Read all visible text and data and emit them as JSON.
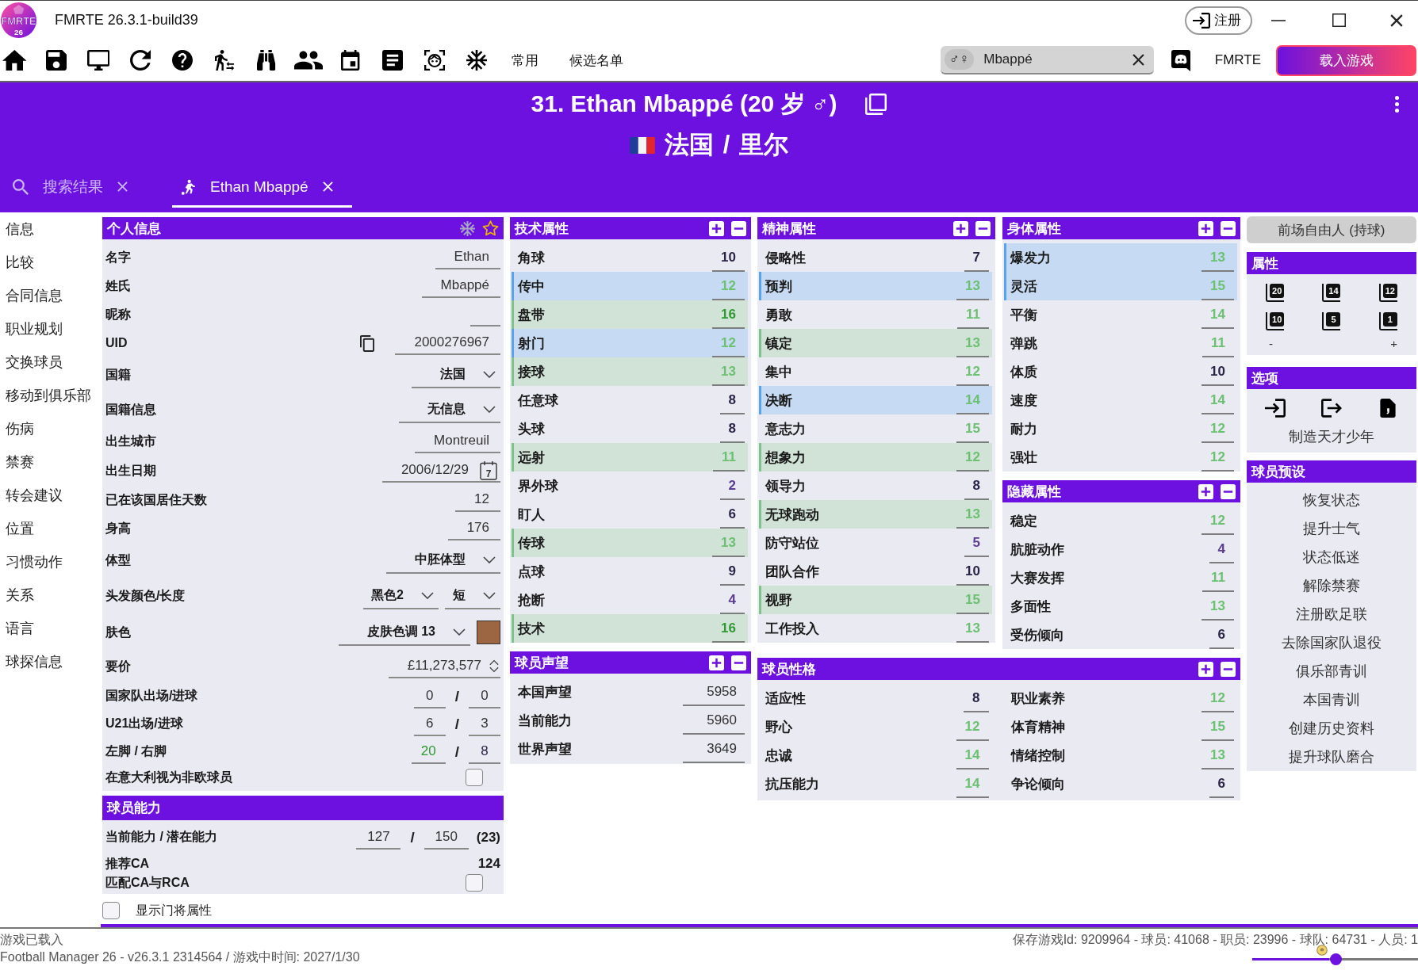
{
  "title_bar": {
    "logo": {
      "text": "FMRTE",
      "badge": "26"
    },
    "title": "FMRTE 26.3.1-build39",
    "register_button": "注册"
  },
  "toolbar": {
    "menus": [
      "常用",
      "候选名单"
    ],
    "search": {
      "gender_toggle": "♂♀",
      "value": "Mbappé"
    },
    "link": "FMRTE",
    "load_button": "载入游戏"
  },
  "player_header": {
    "title": "31. Ethan Mbappé (20 岁 ♂)",
    "nation": "法国",
    "separator": "/",
    "club": "里尔"
  },
  "tabs": [
    {
      "kind": "search",
      "label": "搜索结果",
      "selected": false
    },
    {
      "kind": "player",
      "label": "Ethan Mbappé",
      "selected": true
    }
  ],
  "sidebar": {
    "items": [
      "信息",
      "比较",
      "合同信息",
      "职业规划",
      "交换球员",
      "移动到俱乐部",
      "伤病",
      "禁赛",
      "转会建议",
      "位置",
      "习惯动作",
      "关系",
      "语言",
      "球探信息"
    ]
  },
  "personal_info": {
    "title": "个人信息",
    "fields": [
      {
        "kind": "text",
        "label": "名字",
        "value": "Ethan"
      },
      {
        "kind": "text",
        "label": "姓氏",
        "value": "Mbappé"
      },
      {
        "kind": "text",
        "label": "昵称"
      },
      {
        "kind": "copy",
        "label": "UID",
        "value": "2000276967"
      },
      {
        "kind": "select",
        "label": "国籍",
        "value": "法国"
      },
      {
        "kind": "select",
        "label": "国籍信息",
        "value": "无信息"
      },
      {
        "kind": "text",
        "label": "出生城市",
        "value": "Montreuil"
      },
      {
        "kind": "date",
        "label": "出生日期",
        "value": "2006/12/29",
        "calendar_day": "7"
      },
      {
        "kind": "text",
        "label": "已在该国居住天数",
        "value": "12"
      },
      {
        "kind": "text",
        "label": "身高",
        "value": "176"
      },
      {
        "kind": "select",
        "label": "体型",
        "value": "中胚体型"
      },
      {
        "kind": "select_pair",
        "label": "头发颜色/长度",
        "values": [
          "黑色2",
          "短"
        ]
      },
      {
        "kind": "swatch",
        "label": "肤色",
        "value": "皮肤色调 13",
        "color": "#9b6641"
      },
      {
        "kind": "spin",
        "label": "要价",
        "value": "£11,273,577"
      },
      {
        "kind": "pair",
        "label": "国家队出场/进球",
        "values": [
          "0",
          "0"
        ],
        "separator": "/"
      },
      {
        "kind": "pair",
        "label": "U21出场/进球",
        "values": [
          "6",
          "3"
        ],
        "separator": "/"
      },
      {
        "kind": "rating_pair",
        "label": "左脚 / 右脚",
        "values": [
          "20",
          "8"
        ],
        "separator": "/"
      },
      {
        "kind": "checkbox",
        "label": "在意大利视为非欧球员",
        "checked": false
      }
    ]
  },
  "ability": {
    "title": "球员能力",
    "fields": [
      {
        "kind": "ability",
        "label": "当前能力 / 潜在能力",
        "values": [
          "127",
          "150"
        ],
        "separator": "/",
        "note": "(23)"
      },
      {
        "kind": "strong",
        "label": "推荐CA",
        "value": "124"
      },
      {
        "kind": "checkbox",
        "label": "匹配CA与RCA",
        "checked": false
      }
    ]
  },
  "show_goalkeeper_attributes": {
    "label": "显示门将属性",
    "checked": false
  },
  "technical": {
    "title": "技术属性",
    "rows": [
      {
        "label": "角球",
        "value": "10",
        "key": false,
        "preferred": false
      },
      {
        "label": "传中",
        "value": "12",
        "key": true,
        "preferred": false
      },
      {
        "label": "盘带",
        "value": "16",
        "key": false,
        "preferred": true
      },
      {
        "label": "射门",
        "value": "12",
        "key": true,
        "preferred": false
      },
      {
        "label": "接球",
        "value": "13",
        "key": false,
        "preferred": true
      },
      {
        "label": "任意球",
        "value": "8",
        "key": false,
        "preferred": false
      },
      {
        "label": "头球",
        "value": "8",
        "key": false,
        "preferred": false
      },
      {
        "label": "远射",
        "value": "11",
        "key": false,
        "preferred": true
      },
      {
        "label": "界外球",
        "value": "2",
        "key": false,
        "preferred": false
      },
      {
        "label": "盯人",
        "value": "6",
        "key": false,
        "preferred": false
      },
      {
        "label": "传球",
        "value": "13",
        "key": false,
        "preferred": true
      },
      {
        "label": "点球",
        "value": "9",
        "key": false,
        "preferred": false
      },
      {
        "label": "抢断",
        "value": "4",
        "key": false,
        "preferred": false
      },
      {
        "label": "技术",
        "value": "16",
        "key": false,
        "preferred": true
      }
    ]
  },
  "reputation": {
    "title": "球员声望",
    "rows": [
      {
        "label": "本国声望",
        "value": "5958"
      },
      {
        "label": "当前能力",
        "value": "5960"
      },
      {
        "label": "世界声望",
        "value": "3649"
      }
    ]
  },
  "mental": {
    "title": "精神属性",
    "rows": [
      {
        "label": "侵略性",
        "value": "7",
        "key": false,
        "preferred": false
      },
      {
        "label": "预判",
        "value": "13",
        "key": true,
        "preferred": false
      },
      {
        "label": "勇敢",
        "value": "11",
        "key": false,
        "preferred": false
      },
      {
        "label": "镇定",
        "value": "13",
        "key": false,
        "preferred": true
      },
      {
        "label": "集中",
        "value": "12",
        "key": false,
        "preferred": false
      },
      {
        "label": "决断",
        "value": "14",
        "key": true,
        "preferred": false
      },
      {
        "label": "意志力",
        "value": "15",
        "key": false,
        "preferred": false
      },
      {
        "label": "想象力",
        "value": "12",
        "key": false,
        "preferred": true
      },
      {
        "label": "领导力",
        "value": "8",
        "key": false,
        "preferred": false
      },
      {
        "label": "无球跑动",
        "value": "13",
        "key": false,
        "preferred": true
      },
      {
        "label": "防守站位",
        "value": "5",
        "key": false,
        "preferred": false
      },
      {
        "label": "团队合作",
        "value": "10",
        "key": false,
        "preferred": false
      },
      {
        "label": "视野",
        "value": "15",
        "key": false,
        "preferred": true
      },
      {
        "label": "工作投入",
        "value": "13",
        "key": false,
        "preferred": false
      }
    ]
  },
  "physical": {
    "title": "身体属性",
    "rows": [
      {
        "label": "爆发力",
        "value": "13",
        "key": true,
        "preferred": false
      },
      {
        "label": "灵活",
        "value": "15",
        "key": true,
        "preferred": false
      },
      {
        "label": "平衡",
        "value": "14",
        "key": false,
        "preferred": false
      },
      {
        "label": "弹跳",
        "value": "11",
        "key": false,
        "preferred": false
      },
      {
        "label": "体质",
        "value": "10",
        "key": false,
        "preferred": false
      },
      {
        "label": "速度",
        "value": "14",
        "key": false,
        "preferred": false
      },
      {
        "label": "耐力",
        "value": "12",
        "key": false,
        "preferred": false
      },
      {
        "label": "强壮",
        "value": "12",
        "key": false,
        "preferred": false
      }
    ]
  },
  "hidden": {
    "title": "隐藏属性",
    "rows": [
      {
        "label": "稳定",
        "value": "12"
      },
      {
        "label": "肮脏动作",
        "value": "4"
      },
      {
        "label": "大赛发挥",
        "value": "11"
      },
      {
        "label": "多面性",
        "value": "13"
      },
      {
        "label": "受伤倾向",
        "value": "6"
      }
    ]
  },
  "personality": {
    "title": "球员性格",
    "rows": [
      {
        "label": "适应性",
        "value": "8"
      },
      {
        "label": "职业素养",
        "value": "12"
      },
      {
        "label": "野心",
        "value": "12"
      },
      {
        "label": "体育精神",
        "value": "15"
      },
      {
        "label": "忠诚",
        "value": "14"
      },
      {
        "label": "情绪控制",
        "value": "13"
      },
      {
        "label": "抗压能力",
        "value": "14"
      },
      {
        "label": "争论倾向",
        "value": "6"
      }
    ]
  },
  "role_button": "前场自由人 (持球)",
  "attribute_presets": {
    "title": "属性",
    "buttons": [
      "20",
      "14",
      "12",
      "10",
      "5",
      "1"
    ],
    "decrease": "-",
    "increase": "+"
  },
  "options": {
    "title": "选项",
    "action": "制造天才少年"
  },
  "player_presets": {
    "title": "球员预设",
    "items": [
      "恢复状态",
      "提升士气",
      "状态低迷",
      "解除禁赛",
      "注册欧足联",
      "去除国家队退役",
      "俱乐部青训",
      "本国青训",
      "创建历史资料",
      "提升球队磨合"
    ]
  },
  "status_bar": {
    "messages": [
      "游戏已载入",
      "Football Manager 26 - v26.3.1 2314564 / 游戏中时间: 2027/1/30"
    ],
    "stats": "保存游戏Id: 9209964 - 球员: 41068 - 职员: 23996 - 球队: 64731 - 人员: 1",
    "slider": {
      "level": 0.5
    }
  }
}
